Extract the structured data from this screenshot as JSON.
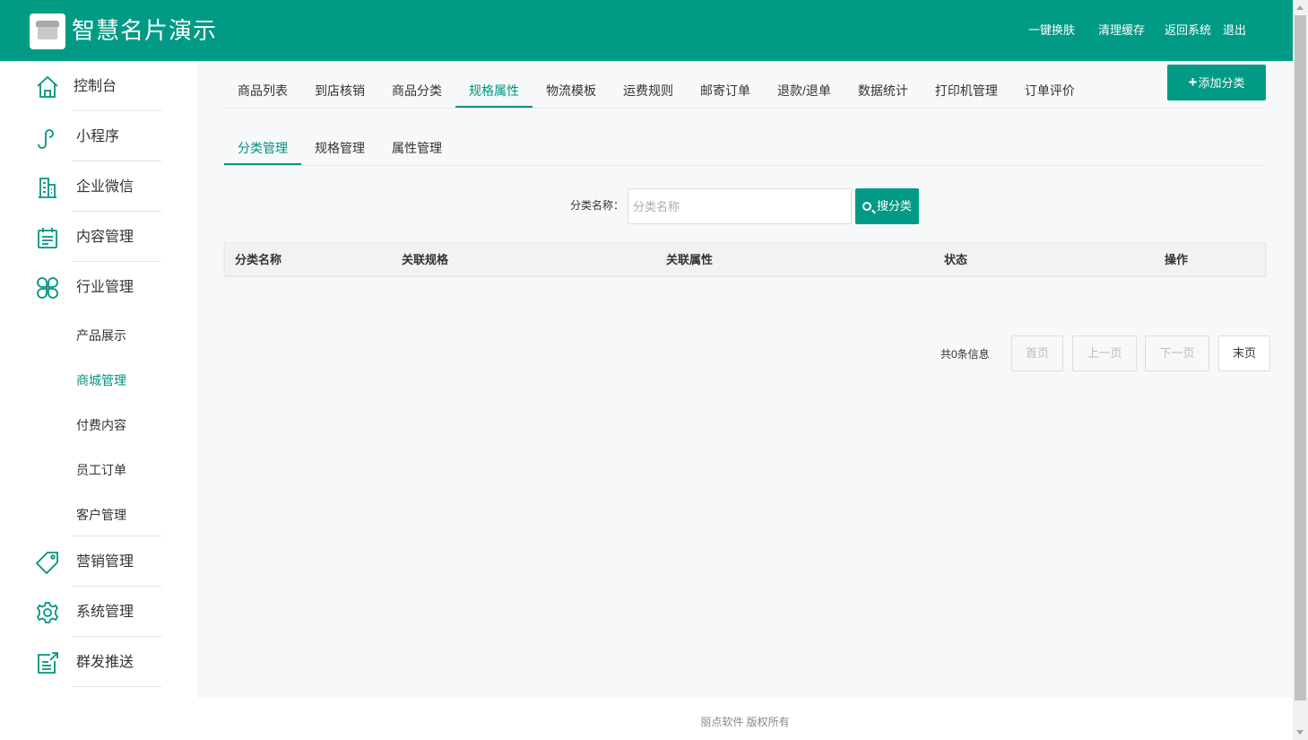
{
  "header": {
    "title": "智慧名片演示",
    "links": [
      "一键换肤",
      "清理缓存",
      "返回系统",
      "退出"
    ],
    "logo_icon": "shop-icon"
  },
  "sidebar": {
    "items": [
      {
        "label": "控制台",
        "icon": "home-icon"
      },
      {
        "label": "小程序",
        "icon": "mini-program-icon"
      },
      {
        "label": "企业微信",
        "icon": "building-icon"
      },
      {
        "label": "内容管理",
        "icon": "clipboard-icon"
      },
      {
        "label": "行业管理",
        "icon": "grid-icon"
      },
      {
        "label": "营销管理",
        "icon": "tag-icon"
      },
      {
        "label": "系统管理",
        "icon": "gear-icon"
      },
      {
        "label": "群发推送",
        "icon": "edit-icon"
      }
    ],
    "sub_items": [
      "产品展示",
      "商城管理",
      "付费内容",
      "员工订单",
      "客户管理"
    ],
    "active_sub": "商城管理"
  },
  "tabs": [
    "商品列表",
    "到店核销",
    "商品分类",
    "规格属性",
    "物流模板",
    "运费规则",
    "邮寄订单",
    "退款/退单",
    "数据统计",
    "打印机管理",
    "订单评价"
  ],
  "active_tab": "规格属性",
  "add_button": {
    "plus": "+",
    "label": "添加分类"
  },
  "subtabs": [
    "分类管理",
    "规格管理",
    "属性管理"
  ],
  "active_subtab": "分类管理",
  "search": {
    "label": "分类名称：",
    "placeholder": "分类名称",
    "value": "",
    "button": "搜分类"
  },
  "table": {
    "columns": [
      "分类名称",
      "关联规格",
      "关联属性",
      "状态",
      "操作"
    ],
    "rows": []
  },
  "pager": {
    "info": "共0条信息",
    "buttons": [
      "首页",
      "上一页",
      "下一页",
      "末页"
    ]
  },
  "footer": "丽点软件 版权所有",
  "colors": {
    "primary": "#009a85",
    "active_text": "#00947f",
    "content_bg": "#f7f8fa"
  }
}
